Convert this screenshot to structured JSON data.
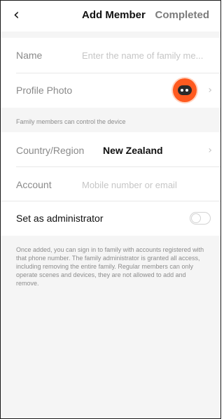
{
  "header": {
    "back_icon": "chevron-left",
    "title": "Add Member",
    "completed_label": "Completed"
  },
  "member_form": {
    "name": {
      "label": "Name",
      "placeholder": "Enter the name of family me..."
    },
    "profile_photo": {
      "label": "Profile Photo",
      "avatar_color": "#ff5a1f"
    },
    "note": "Family members can control the device",
    "country_region": {
      "label": "Country/Region",
      "value": "New Zealand"
    },
    "account": {
      "label": "Account",
      "placeholder": "Mobile number or email"
    },
    "admin": {
      "label": "Set as administrator",
      "enabled": false
    }
  },
  "info_text": "Once added, you can sign in to family with accounts registered with that phone number. The family administrator is granted all access, including removing the entire family. Regular members can only operate scenes and devices, they are not allowed to add and remove."
}
